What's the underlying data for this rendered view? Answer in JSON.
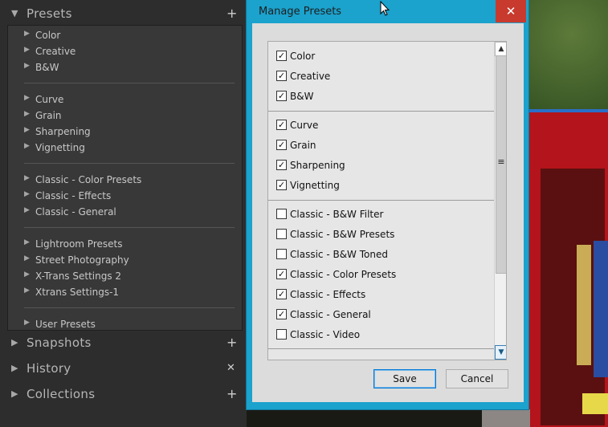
{
  "left_panel": {
    "presets": {
      "title": "Presets",
      "action_icon": "plus-icon"
    },
    "groups": [
      [
        "Color",
        "Creative",
        "B&W"
      ],
      [
        "Curve",
        "Grain",
        "Sharpening",
        "Vignetting"
      ],
      [
        "Classic - Color Presets",
        "Classic - Effects",
        "Classic - General"
      ],
      [
        "Lightroom Presets",
        "Street Photography",
        "X-Trans Settings 2",
        "Xtrans Settings-1"
      ],
      [
        "User Presets"
      ]
    ],
    "snapshots": {
      "title": "Snapshots",
      "action_icon": "plus-icon"
    },
    "history": {
      "title": "History",
      "action_icon": "close-icon"
    },
    "collections": {
      "title": "Collections",
      "action_icon": "plus-icon"
    }
  },
  "dialog": {
    "title": "Manage Presets",
    "close_glyph": "✕",
    "groups": [
      [
        {
          "label": "Color",
          "checked": true
        },
        {
          "label": "Creative",
          "checked": true
        },
        {
          "label": "B&W",
          "checked": true
        }
      ],
      [
        {
          "label": "Curve",
          "checked": true
        },
        {
          "label": "Grain",
          "checked": true
        },
        {
          "label": "Sharpening",
          "checked": true
        },
        {
          "label": "Vignetting",
          "checked": true
        }
      ],
      [
        {
          "label": "Classic - B&W Filter",
          "checked": false
        },
        {
          "label": "Classic - B&W Presets",
          "checked": false
        },
        {
          "label": "Classic - B&W Toned",
          "checked": false
        },
        {
          "label": "Classic - Color Presets",
          "checked": true
        },
        {
          "label": "Classic - Effects",
          "checked": true
        },
        {
          "label": "Classic - General",
          "checked": true
        },
        {
          "label": "Classic - Video",
          "checked": false
        }
      ]
    ],
    "save_label": "Save",
    "cancel_label": "Cancel"
  },
  "colors": {
    "title_bar": "#1ba2cd",
    "close_button": "#c83a2e",
    "panel_bg": "#2d2d2d"
  }
}
